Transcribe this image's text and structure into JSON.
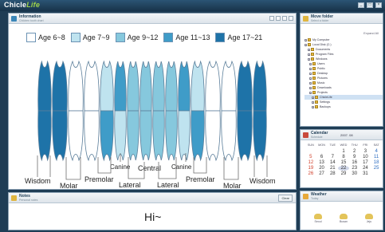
{
  "app": {
    "logo_main": "Chicle",
    "logo_accent": "Life",
    "window_buttons": [
      "_",
      "□",
      "×"
    ]
  },
  "info_panel": {
    "title": "Information",
    "subtitle": "Children tooth chart",
    "legend": [
      {
        "label": "Age 6~8",
        "color": "#ffffff"
      },
      {
        "label": "Age 7~9",
        "color": "#bfe3ef"
      },
      {
        "label": "Age 9~12",
        "color": "#86c8dd"
      },
      {
        "label": "Age 11~13",
        "color": "#3f9cc8"
      },
      {
        "label": "Age 17~21",
        "color": "#1e73a8"
      }
    ],
    "tooth_labels": {
      "wisdom_left": "Wisdom",
      "molar_left": "Molar",
      "premolar_left": "Premolar",
      "canine_left": "Canine",
      "lateral_left": "Lateral",
      "central": "Central",
      "lateral_right": "Lateral",
      "canine_right": "Canine",
      "premolar_right": "Premolar",
      "molar_right": "Molar",
      "wisdom_right": "Wisdom"
    }
  },
  "notes_panel": {
    "title": "Notes",
    "subtitle": "Personal notes",
    "button": "Clear",
    "text": "Hi~"
  },
  "move_panel": {
    "title": "Move folder",
    "subtitle": "Select a folder",
    "hint": "Expand All",
    "tree": [
      {
        "label": "My Computer",
        "selected": false
      },
      {
        "label": "Local Disk (C:)",
        "selected": false
      },
      {
        "label": "Documents",
        "selected": false
      },
      {
        "label": "Program Files",
        "selected": false
      },
      {
        "label": "Windows",
        "selected": false
      },
      {
        "label": "Users",
        "selected": false
      },
      {
        "label": "Public",
        "selected": false
      },
      {
        "label": "Desktop",
        "selected": false
      },
      {
        "label": "Pictures",
        "selected": false
      },
      {
        "label": "Music",
        "selected": false
      },
      {
        "label": "Downloads",
        "selected": false
      },
      {
        "label": "Projects",
        "selected": false
      },
      {
        "label": "ChicleLife",
        "selected": true
      },
      {
        "label": "Settings",
        "selected": false
      },
      {
        "label": "Backups",
        "selected": false
      }
    ]
  },
  "calendar_panel": {
    "title": "Calendar",
    "subtitle": "Schedule",
    "nav": "2007. 08",
    "weekdays": [
      "SUN",
      "MON",
      "TUE",
      "WED",
      "THU",
      "FRI",
      "SAT"
    ],
    "days": [
      "",
      "",
      "",
      "1",
      "2",
      "3",
      "4",
      "5",
      "6",
      "7",
      "8",
      "9",
      "10",
      "11",
      "12",
      "13",
      "14",
      "15",
      "16",
      "17",
      "18",
      "19",
      "20",
      "21",
      "22",
      "23",
      "24",
      "25",
      "26",
      "27",
      "28",
      "29",
      "30",
      "31",
      ""
    ],
    "today": "22"
  },
  "weather_panel": {
    "title": "Weather",
    "subtitle": "Today",
    "items": [
      {
        "icon": "sun-cloud-icon",
        "label": "Seoul"
      },
      {
        "icon": "sun-icon",
        "label": "Busan"
      },
      {
        "icon": "sun-icon",
        "label": "Jeju"
      }
    ]
  }
}
